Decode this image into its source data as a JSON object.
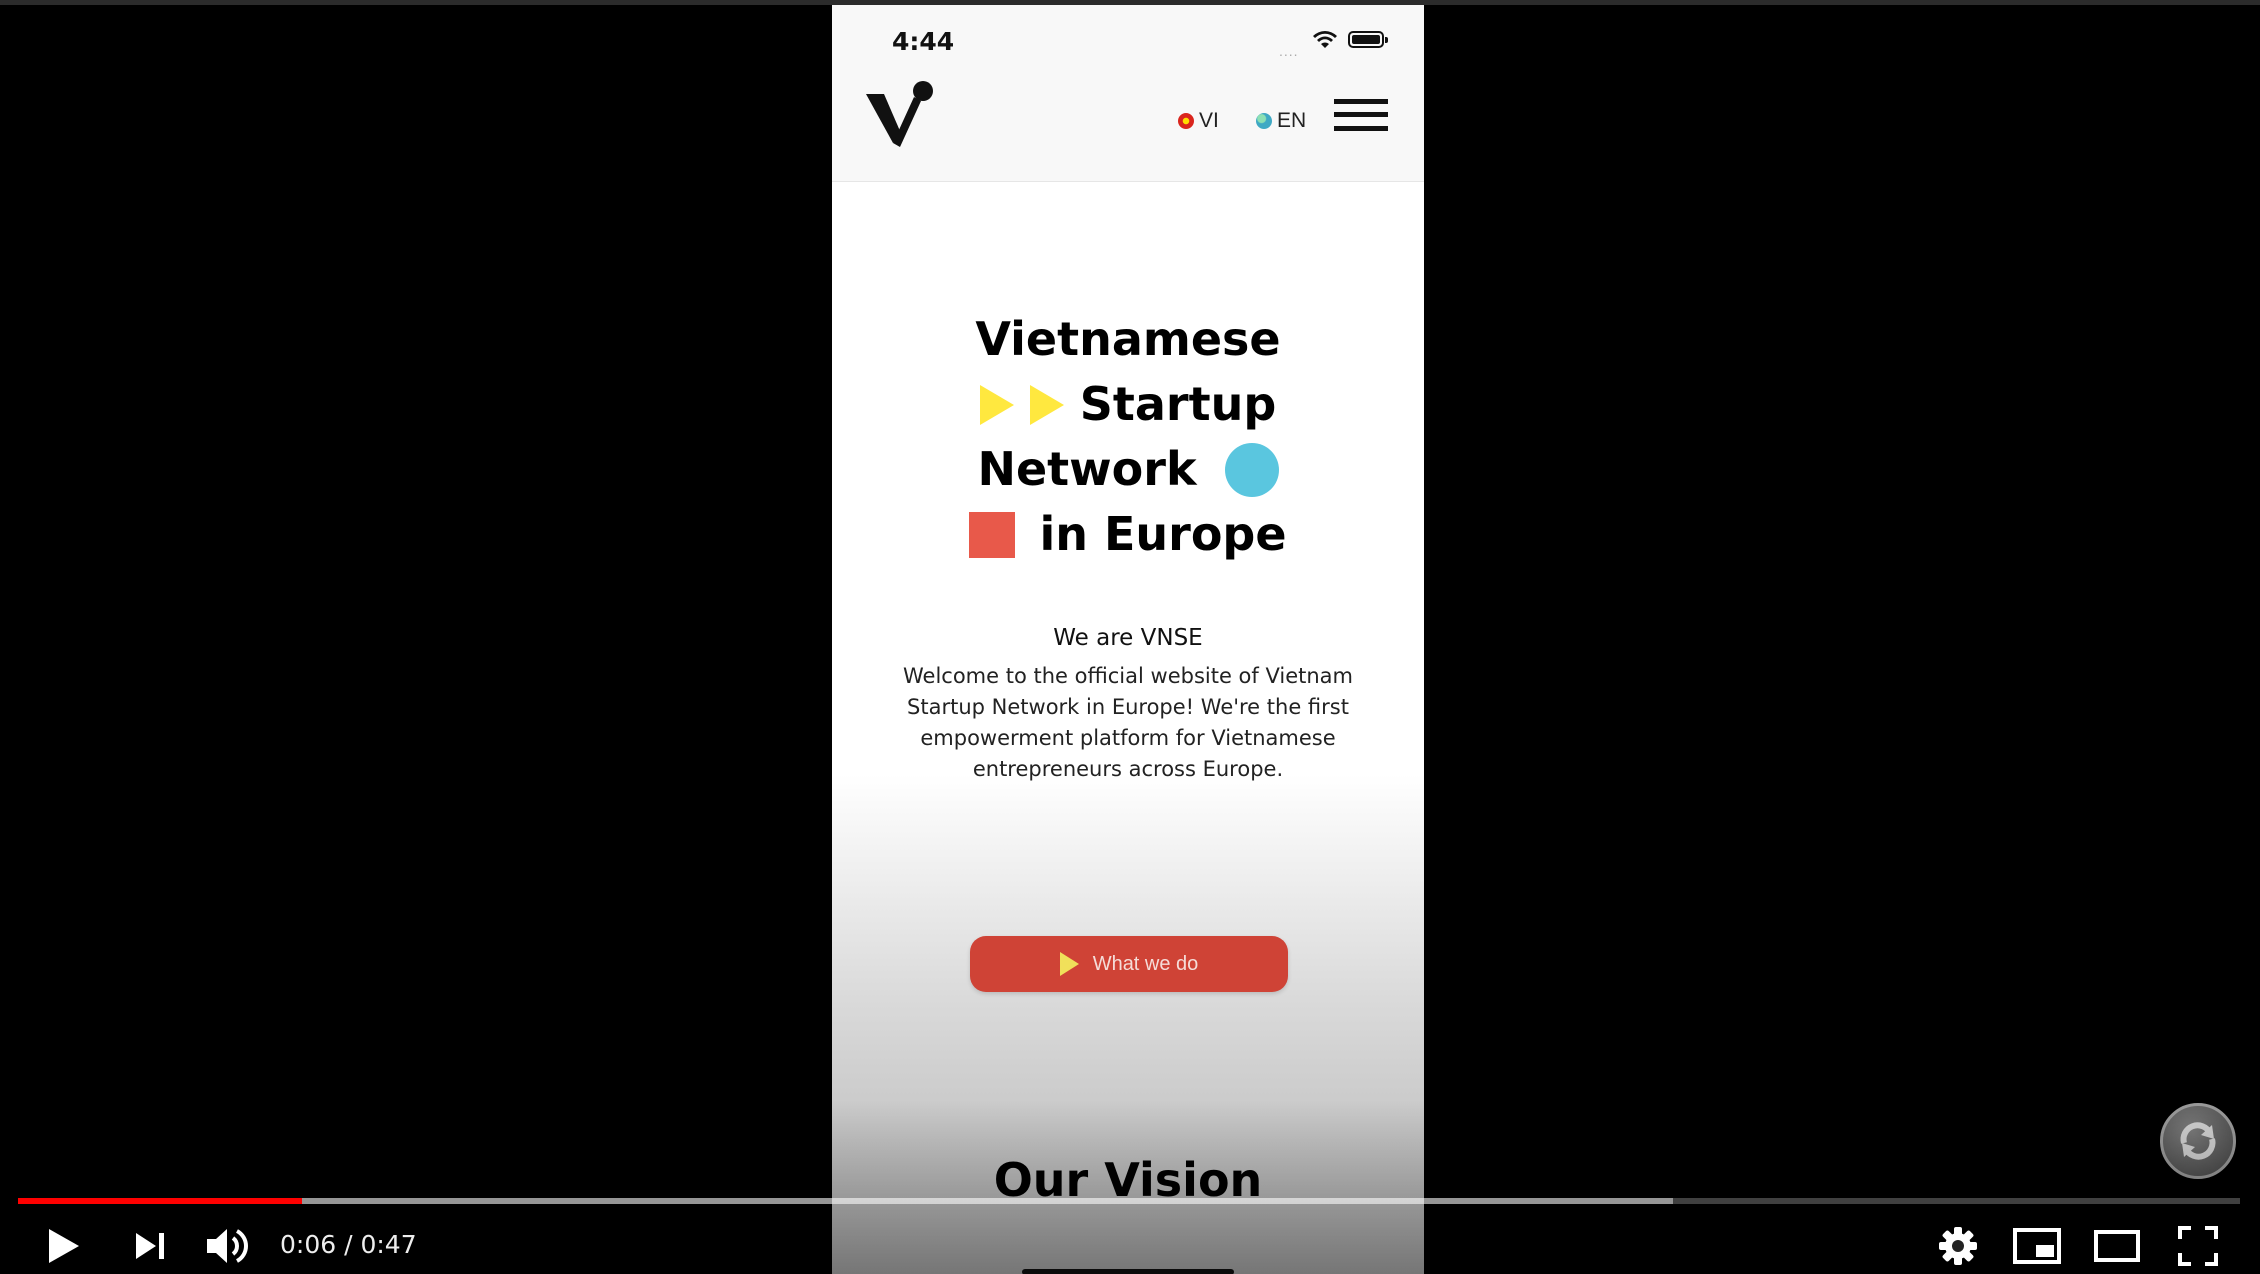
{
  "status_bar": {
    "time": "4:44",
    "signal": "....",
    "wifi": "wifi-icon",
    "battery": "battery-icon"
  },
  "navbar": {
    "logo": "vnse-logo",
    "languages": [
      {
        "code": "VI",
        "flag": "vietnam-flag-icon"
      },
      {
        "code": "EN",
        "flag": "globe-icon"
      }
    ],
    "menu_icon": "hamburger-icon"
  },
  "hero": {
    "lines": [
      "Vietnamese",
      "Startup",
      "Network",
      "in Europe"
    ],
    "shape_colors": {
      "triangle": "#ffe83f",
      "circle": "#5ac6df",
      "square": "#e8594a"
    }
  },
  "intro": {
    "subtitle": "We are VNSE",
    "description": "Welcome to the official website of Vietnam Startup Network in Europe! We're the first empowerment platform for Vietnamese entrepreneurs across Europe."
  },
  "cta": {
    "label": "What we do",
    "color": "#cf4336"
  },
  "section": {
    "title": "Our Vision"
  },
  "player": {
    "current_time": "0:06",
    "duration": "0:47",
    "time_display": "0:06 / 0:47",
    "played_fraction": 0.1276,
    "buffered_fraction": 0.745,
    "buttons": [
      "play-icon",
      "next-icon",
      "volume-icon",
      "settings-icon",
      "miniplayer-icon",
      "theater-mode-icon",
      "fullscreen-icon"
    ],
    "accent_color": "#ff0000"
  }
}
